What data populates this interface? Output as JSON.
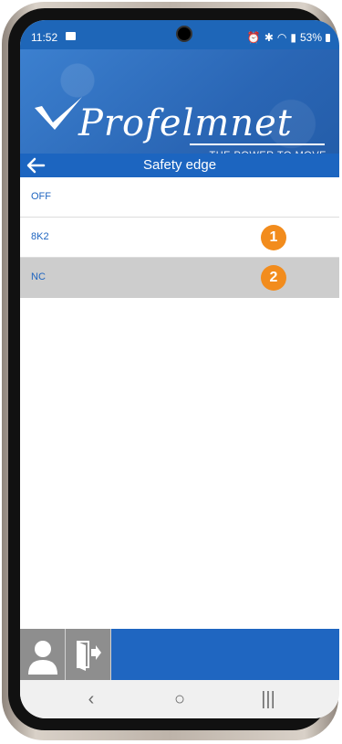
{
  "status": {
    "time": "11:52",
    "battery": "53%"
  },
  "brand": {
    "name": "Profelmnet",
    "tagline": "THE POWER TO MOVE"
  },
  "title": "Safety edge",
  "options": [
    {
      "label": "OFF",
      "badge": ""
    },
    {
      "label": "8K2",
      "badge": "1"
    },
    {
      "label": "NC",
      "badge": "2",
      "selected": true
    }
  ],
  "colors": {
    "accent": "#1c65c0",
    "badge": "#f28c1d",
    "selected_row": "#cdcdcd"
  },
  "icons": {
    "back": "arrow-left-icon",
    "user": "user-icon",
    "logout": "logout-icon",
    "nav_back": "nav-back-icon",
    "nav_home": "nav-home-icon",
    "nav_recents": "nav-recents-icon"
  }
}
